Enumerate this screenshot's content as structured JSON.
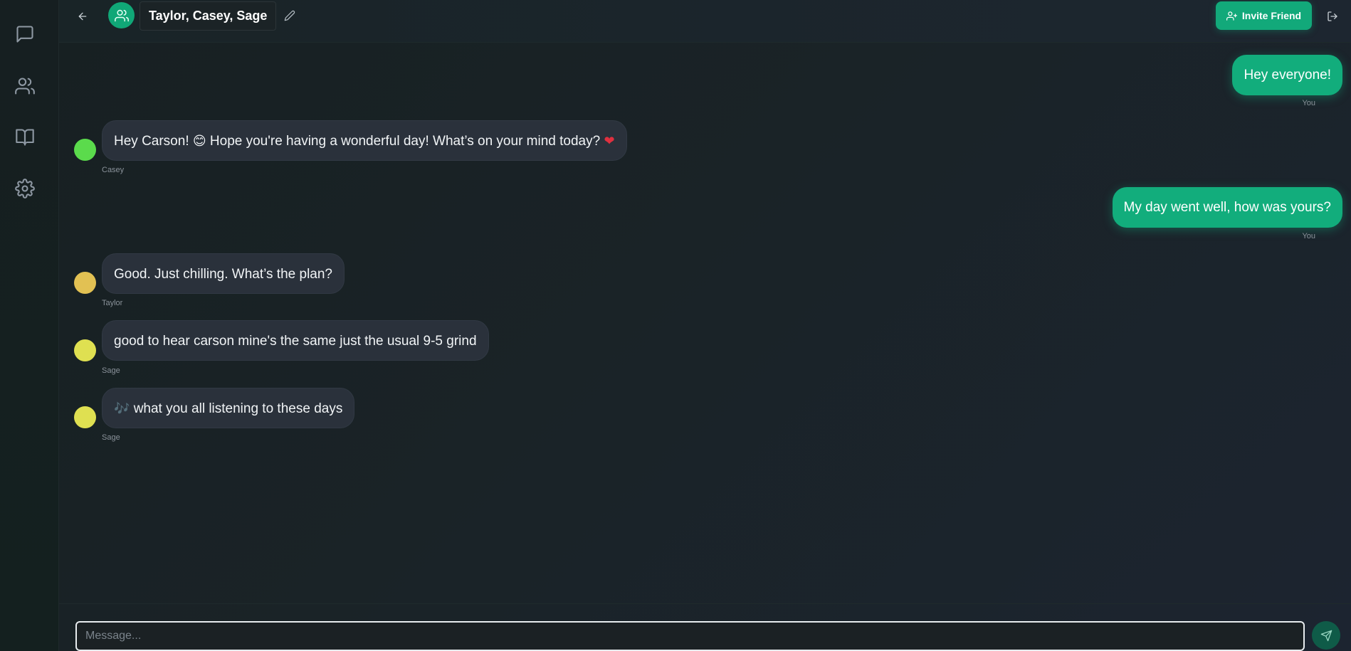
{
  "sidebar": {
    "items": [
      {
        "name": "chat",
        "icon": "message-square-icon"
      },
      {
        "name": "friends",
        "icon": "users-icon"
      },
      {
        "name": "library",
        "icon": "book-open-icon"
      },
      {
        "name": "settings",
        "icon": "gear-icon"
      }
    ]
  },
  "header": {
    "title": "Taylor, Casey, Sage",
    "invite_label": "Invite Friend"
  },
  "messages": [
    {
      "sender": "You",
      "text": "Hey everyone!",
      "outgoing": true
    },
    {
      "sender": "Casey",
      "text_before": "Hey Carson! ",
      "emoji_1": "😊",
      "text_after": " Hope you're having a wonderful day! What’s on your mind today? ",
      "emoji_2": "❤",
      "avatar_color": "#5bdb4c"
    },
    {
      "sender": "You",
      "text": "My day went well, how was yours?",
      "outgoing": true
    },
    {
      "sender": "Taylor",
      "text": "Good. Just chilling. What’s the plan?",
      "avatar_color": "#e2c153"
    },
    {
      "sender": "Sage",
      "text": "good to hear carson mine's the same just the usual 9-5 grind",
      "avatar_color": "#dfe051"
    },
    {
      "sender": "Sage",
      "emoji": "🎶",
      "text": "what you all listening to these days",
      "avatar_color": "#dfe051"
    }
  ],
  "composer": {
    "placeholder": "Message..."
  },
  "colors": {
    "accent": "#12ad7c",
    "incoming_bubble": "#2a313b",
    "background": "#151d1f"
  }
}
